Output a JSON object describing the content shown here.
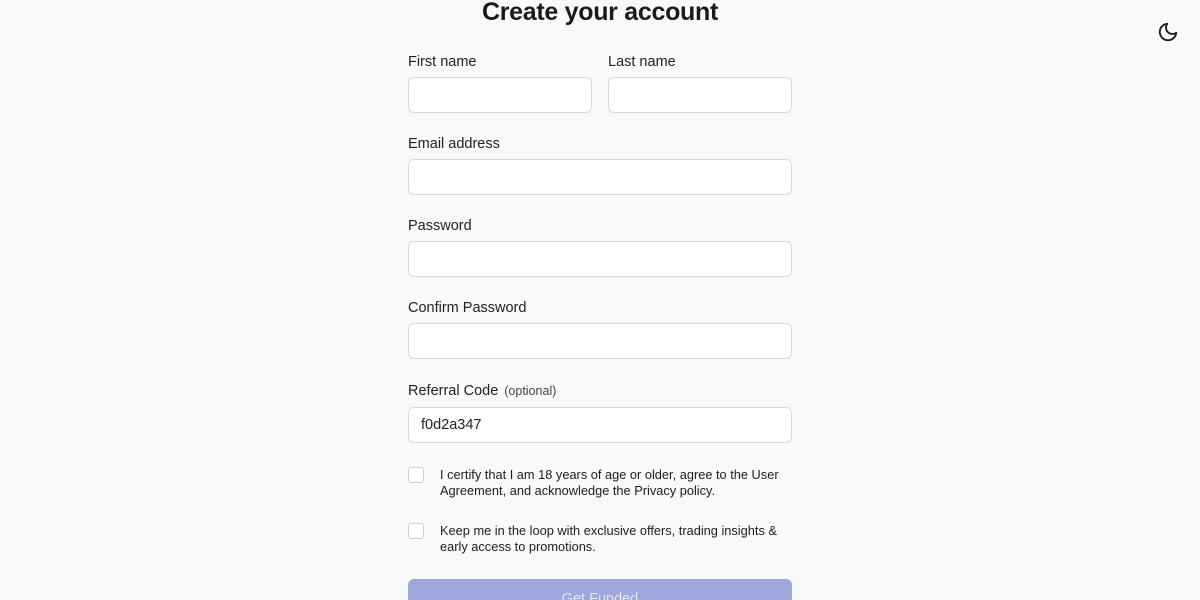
{
  "header": {
    "title": "Create your account",
    "theme_toggle_icon": "moon-icon"
  },
  "form": {
    "first_name": {
      "label": "First name",
      "value": ""
    },
    "last_name": {
      "label": "Last name",
      "value": ""
    },
    "email": {
      "label": "Email address",
      "value": ""
    },
    "password": {
      "label": "Password",
      "value": ""
    },
    "confirm_password": {
      "label": "Confirm Password",
      "value": ""
    },
    "referral_code": {
      "label": "Referral Code",
      "optional_hint": "(optional)",
      "value": "f0d2a347"
    },
    "certify_checkbox": {
      "checked": false,
      "text": "I certify that I am 18 years of age or older, agree to the User Agreement, and acknowledge the Privacy policy."
    },
    "marketing_checkbox": {
      "checked": false,
      "text": "Keep me in the loop with exclusive offers, trading insights & early access to promotions."
    },
    "submit_label": "Get Funded"
  },
  "colors": {
    "background": "#f9f9f9",
    "button_disabled": "#9ea6dc",
    "input_border": "#d9d9d9"
  }
}
